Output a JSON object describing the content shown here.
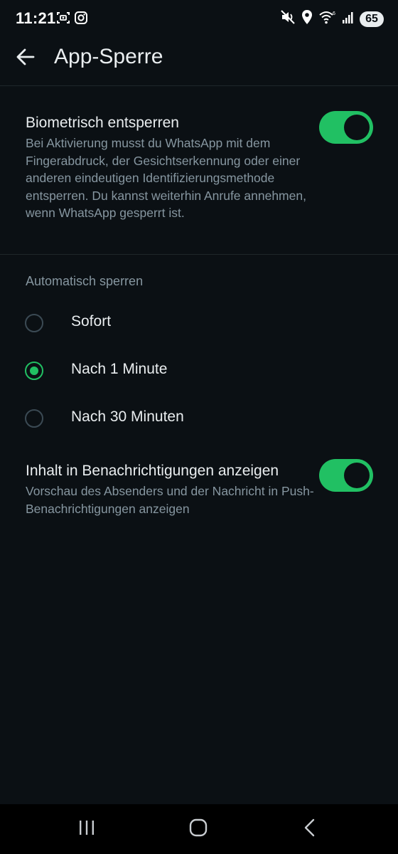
{
  "status_bar": {
    "time": "11:21",
    "battery": "65",
    "left_icons": [
      "screenshot-icon",
      "instagram-icon"
    ],
    "right_icons": [
      "mute-icon",
      "location-icon",
      "wifi-icon",
      "signal-icon"
    ]
  },
  "app_bar": {
    "title": "App-Sperre",
    "back_icon": "arrow-back-icon"
  },
  "biometric": {
    "title": "Biometrisch entsperren",
    "description": "Bei Aktivierung musst du WhatsApp mit dem Fingerabdruck, der Gesichtserkennung oder einer anderen eindeutigen Identifizierungsmethode entsperren. Du kannst weiterhin Anrufe annehmen, wenn WhatsApp gesperrt ist.",
    "enabled": true
  },
  "auto_lock": {
    "header": "Automatisch sperren",
    "options": [
      {
        "label": "Sofort",
        "selected": false
      },
      {
        "label": "Nach 1 Minute",
        "selected": true
      },
      {
        "label": "Nach 30 Minuten",
        "selected": false
      }
    ]
  },
  "notifications": {
    "title": "Inhalt in Benachrichtigungen anzeigen",
    "description": "Vorschau des Absenders und der Nachricht in Push-Benachrichtigungen anzeigen",
    "enabled": true
  },
  "nav_bar": {
    "icons": [
      "recent-apps-icon",
      "home-icon",
      "back-icon"
    ]
  },
  "colors": {
    "background": "#0b1014",
    "accent": "#21c063",
    "text_primary": "#e9edef",
    "text_secondary": "#8696a0"
  }
}
